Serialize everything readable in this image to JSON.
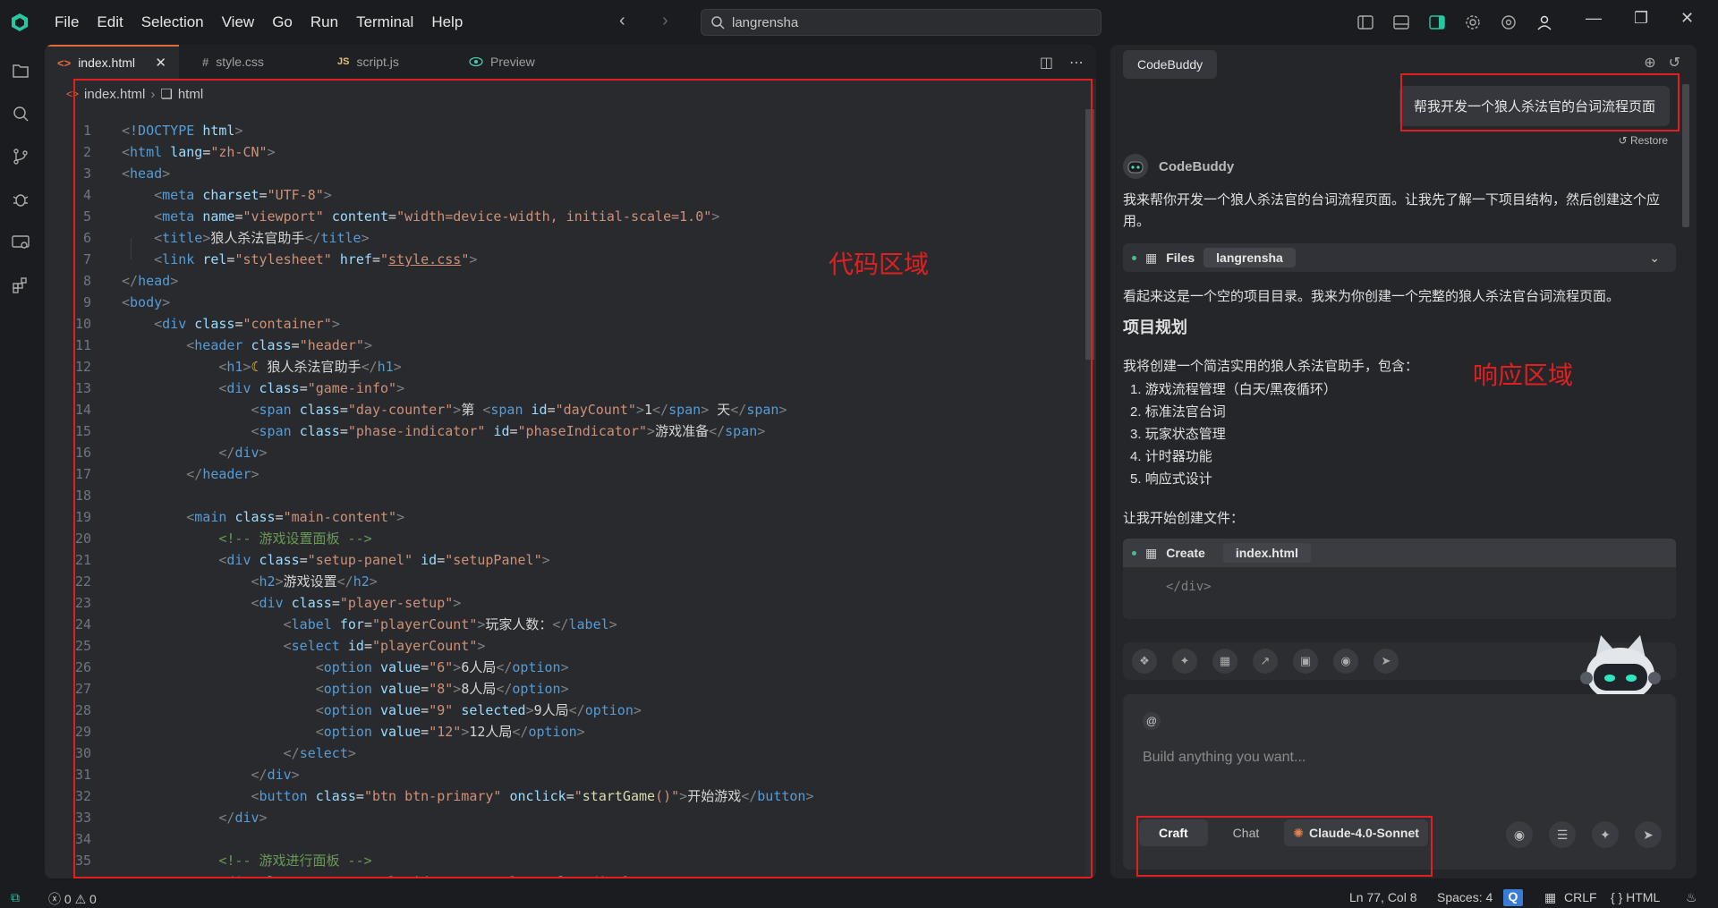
{
  "menu": [
    "File",
    "Edit",
    "Selection",
    "View",
    "Go",
    "Run",
    "Terminal",
    "Help"
  ],
  "search": {
    "value": "langrensha"
  },
  "tabs": [
    {
      "label": "index.html",
      "icon": "html-icon"
    },
    {
      "label": "style.css",
      "icon": "css-icon"
    },
    {
      "label": "script.js",
      "icon": "js-icon"
    },
    {
      "label": "Preview",
      "icon": "eye-icon"
    }
  ],
  "breadcrumb": {
    "file": "index.html",
    "node": "html"
  },
  "code_label": "代码区域",
  "response_label": "响应区域",
  "panel": {
    "tab": "CodeBuddy",
    "user_message": "帮我开发一个狼人杀法官的台词流程页面",
    "restore": "Restore",
    "bot_name": "CodeBuddy",
    "intro": "我来帮你开发一个狼人杀法官的台词流程页面。让我先了解一下项目结构，然后创建这个应用。",
    "files_card": {
      "title": "Files",
      "chip": "langrensha"
    },
    "empty_note": "看起来这是一个空的项目目录。我来为你创建一个完整的狼人杀法官台词流程页面。",
    "heading": "项目规划",
    "plan_intro": "我将创建一个简洁实用的狼人杀法官助手，包含：",
    "plan_items": [
      "游戏流程管理（白天/黑夜循环）",
      "标准法官台词",
      "玩家状态管理",
      "计时器功能",
      "响应式设计"
    ],
    "start_note": "让我开始创建文件：",
    "create_card": {
      "title": "Create",
      "chip": "index.html",
      "code_line": "</div>"
    },
    "input": {
      "at": "@",
      "placeholder": "Build anything you want...",
      "modes": [
        "Craft",
        "Chat"
      ],
      "model": "Claude-4.0-Sonnet"
    }
  },
  "status": {
    "errors": "0",
    "warnings": "0",
    "position": "Ln 77, Col 8",
    "spaces": "Spaces: 4",
    "eol": "CRLF",
    "lang": "HTML"
  }
}
